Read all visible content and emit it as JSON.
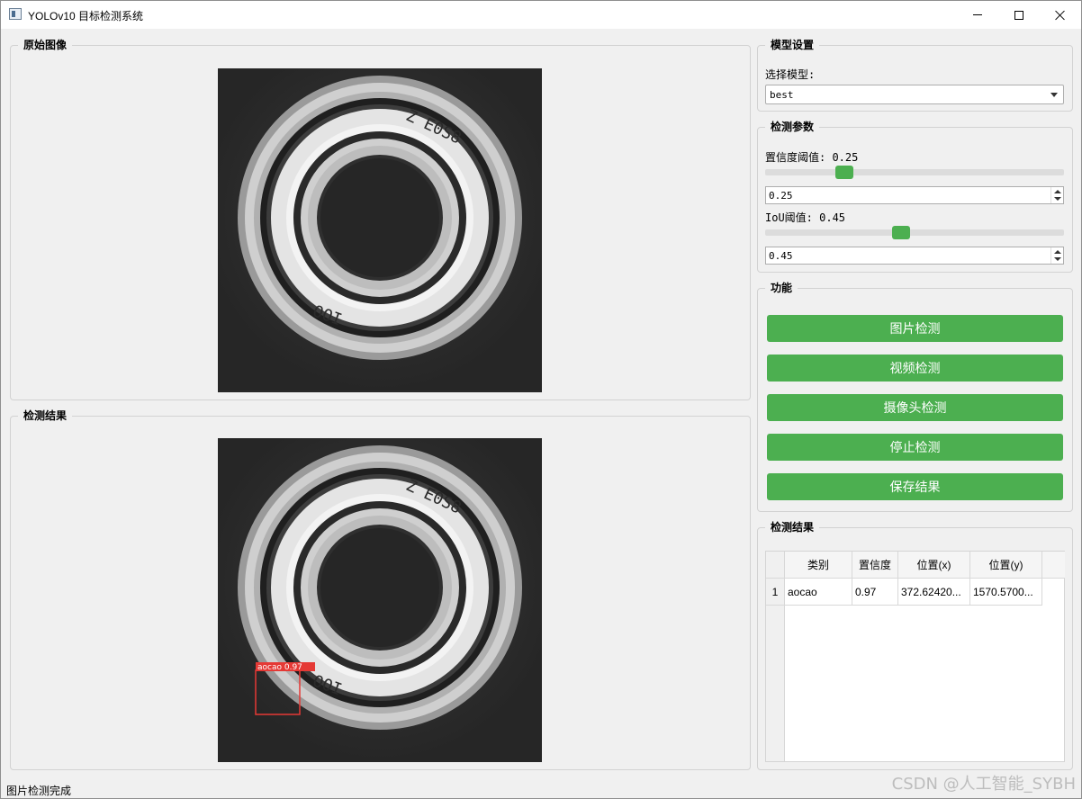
{
  "window": {
    "title": "YOLOv10 目标检测系统"
  },
  "panels": {
    "original_image": {
      "title": "原始图像"
    },
    "result_image": {
      "title": "检测结果",
      "detection_label": "aocao  0.97"
    }
  },
  "model_settings": {
    "title": "模型设置",
    "select_label": "选择模型:",
    "selected_model": "best"
  },
  "detection_params": {
    "title": "检测参数",
    "confidence_label": "置信度阈值: 0.25",
    "confidence_value": "0.25",
    "confidence_level": 0.25,
    "iou_label": "IoU阈值: 0.45",
    "iou_value": "0.45",
    "iou_level": 0.45
  },
  "functions": {
    "title": "功能",
    "buttons": [
      "图片检测",
      "视频检测",
      "摄像头检测",
      "停止检测",
      "保存结果"
    ]
  },
  "results_table": {
    "title": "检测结果",
    "headers": [
      "类别",
      "置信度",
      "位置(x)",
      "位置(y)"
    ],
    "rows": [
      {
        "index": "1",
        "class": "aocao",
        "confidence": "0.97",
        "x": "372.62420...",
        "y": "1570.5700..."
      }
    ]
  },
  "status_bar": {
    "text": "图片检测完成"
  },
  "watermark": "CSDN @人工智能_SYBH",
  "colors": {
    "accent_green": "#4caf50",
    "box_red": "#e53935"
  },
  "icons": [
    "app-icon",
    "minimize-icon",
    "maximize-icon",
    "close-icon",
    "dropdown-arrow-icon",
    "spin-up-icon",
    "spin-down-icon"
  ]
}
